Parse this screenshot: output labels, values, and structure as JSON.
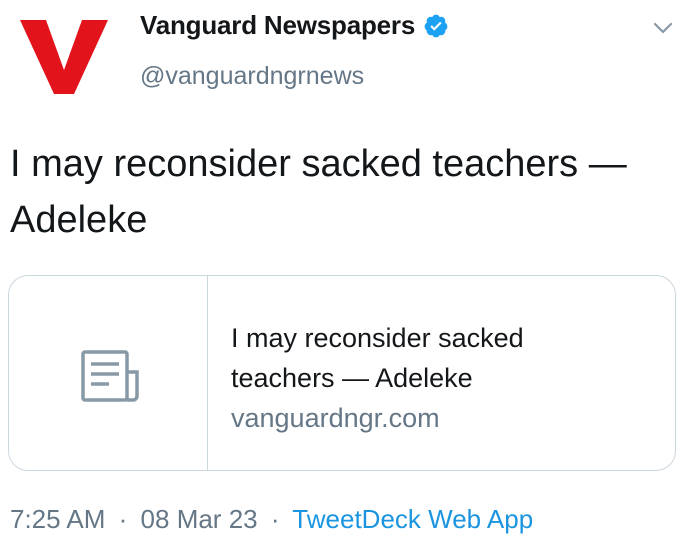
{
  "author": {
    "display_name": "Vanguard Newspapers",
    "handle": "@vanguardngrnews",
    "verified": true,
    "avatar_icon": "vanguard-v-logo-icon",
    "avatar_color": "#e3131b"
  },
  "tweet": {
    "text": "I may reconsider sacked teachers — Adeleke"
  },
  "card": {
    "thumbnail_icon": "document-icon",
    "title_line1": "I may reconsider sacked",
    "title_line2": "teachers — Adeleke",
    "domain": "vanguardngr.com"
  },
  "meta": {
    "time": "7:25 AM",
    "date": "08 Mar 23",
    "separator": "·",
    "source": "TweetDeck Web App"
  },
  "colors": {
    "text": "#14171a",
    "secondary": "#657786",
    "link": "#1b95e0",
    "verified_badge": "#1da1f2",
    "border": "#ccd6dd"
  },
  "icons": {
    "verified": "verified-badge-icon",
    "menu": "chevron-down-icon"
  }
}
